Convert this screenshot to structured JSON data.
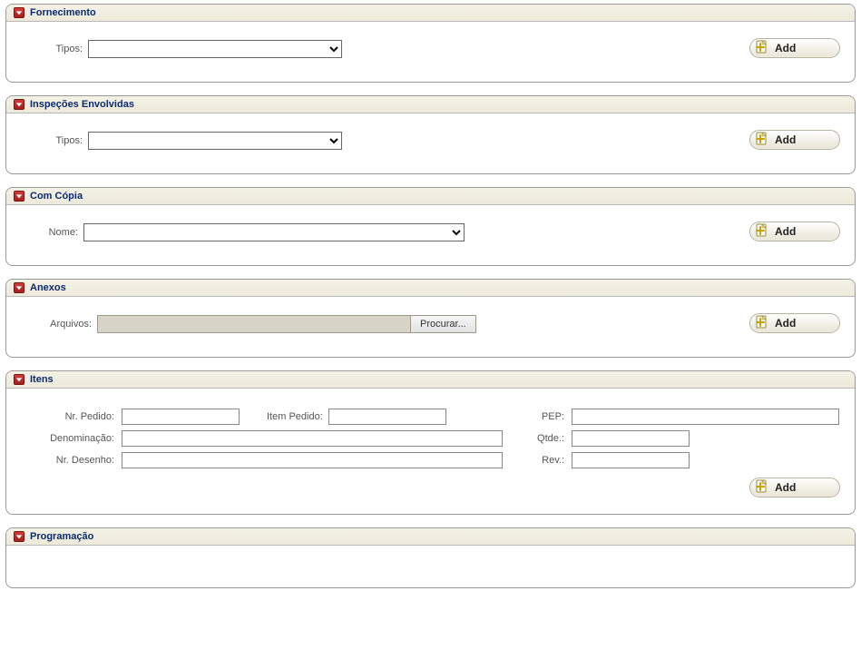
{
  "buttons": {
    "add": "Add",
    "browse": "Procurar..."
  },
  "sections": {
    "fornecimento": {
      "title": "Fornecimento",
      "tipos_label": "Tipos:"
    },
    "inspecoes": {
      "title": "Inspeções Envolvidas",
      "tipos_label": "Tipos:"
    },
    "comcopia": {
      "title": "Com Cópia",
      "nome_label": "Nome:"
    },
    "anexos": {
      "title": "Anexos",
      "arquivos_label": "Arquivos:"
    },
    "itens": {
      "title": "Itens",
      "nr_pedido_label": "Nr. Pedido:",
      "item_pedido_label": "Item Pedido:",
      "pep_label": "PEP:",
      "denominacao_label": "Denominação:",
      "qtde_label": "Qtde.:",
      "nr_desenho_label": "Nr. Desenho:",
      "rev_label": "Rev.:"
    },
    "programacao": {
      "title": "Programação"
    }
  }
}
